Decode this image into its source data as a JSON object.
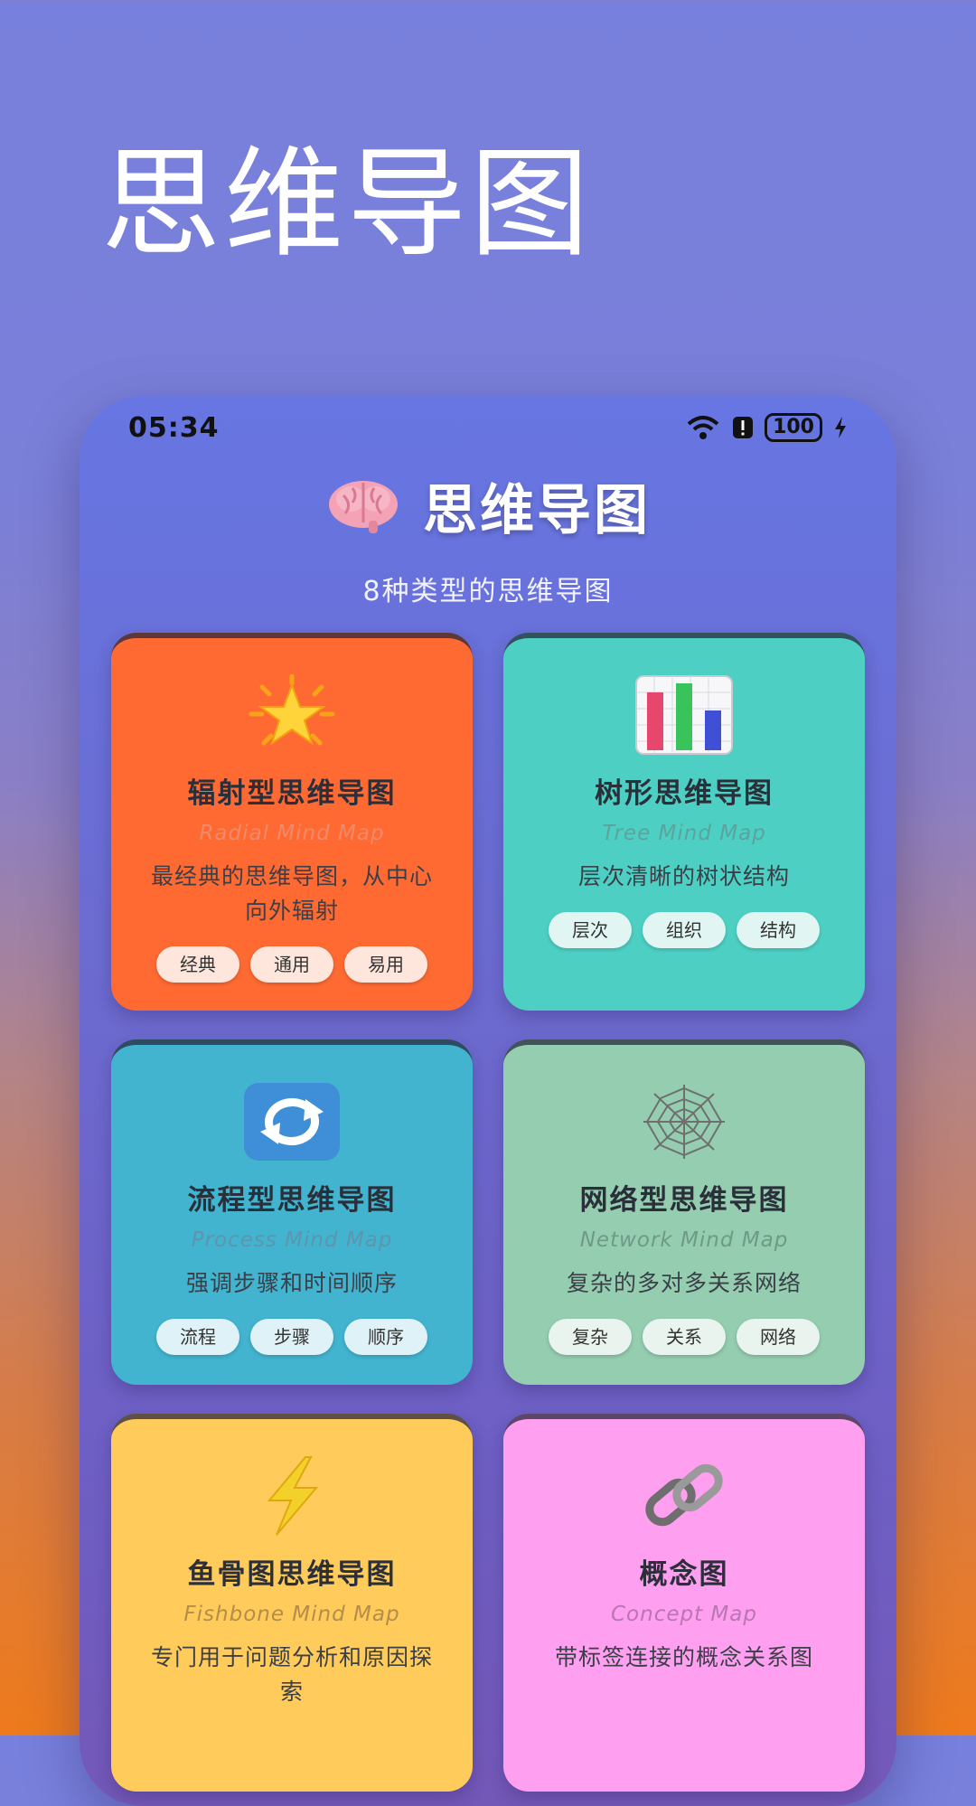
{
  "promo": {
    "title": "思维导图"
  },
  "status_bar": {
    "time": "05:34",
    "battery": "100"
  },
  "header": {
    "title": "思维导图",
    "subtitle": "8种类型的思维导图"
  },
  "cards": [
    {
      "title": "辐射型思维导图",
      "en": "Radial Mind Map",
      "desc": "最经典的思维导图，从中心向外辐射",
      "icon": "star-icon",
      "color": "#ff6a33",
      "en_color": "#f08a6a",
      "tag_bg": "#ffe6dc",
      "tags": [
        "经典",
        "通用",
        "易用"
      ]
    },
    {
      "title": "树形思维导图",
      "en": "Tree Mind Map",
      "desc": "层次清晰的树状结构",
      "icon": "bar-chart-icon",
      "color": "#4dd0c3",
      "en_color": "#5aa49c",
      "tag_bg": "#e1f6f3",
      "tags": [
        "层次",
        "组织",
        "结构"
      ]
    },
    {
      "title": "流程型思维导图",
      "en": "Process Mind Map",
      "desc": "强调步骤和时间顺序",
      "icon": "repeat-arrows-icon",
      "color": "#42b4cf",
      "en_color": "#5e95ad",
      "tag_bg": "#dff2f7",
      "tags": [
        "流程",
        "步骤",
        "顺序"
      ]
    },
    {
      "title": "网络型思维导图",
      "en": "Network Mind Map",
      "desc": "复杂的多对多关系网络",
      "icon": "spider-web-icon",
      "color": "#95cdb0",
      "en_color": "#6e9a86",
      "tag_bg": "#e8f4ed",
      "tags": [
        "复杂",
        "关系",
        "网络"
      ]
    },
    {
      "title": "鱼骨图思维导图",
      "en": "Fishbone Mind Map",
      "desc": "专门用于问题分析和原因探索",
      "icon": "lightning-icon",
      "color": "#ffcb5a",
      "en_color": "#b38d4a",
      "tag_bg": "#fff2d8",
      "tags": []
    },
    {
      "title": "概念图",
      "en": "Concept Map",
      "desc": "带标签连接的概念关系图",
      "icon": "chain-link-icon",
      "color": "#ff9ff0",
      "en_color": "#b877b0",
      "tag_bg": "#ffe8fb",
      "tags": []
    }
  ]
}
